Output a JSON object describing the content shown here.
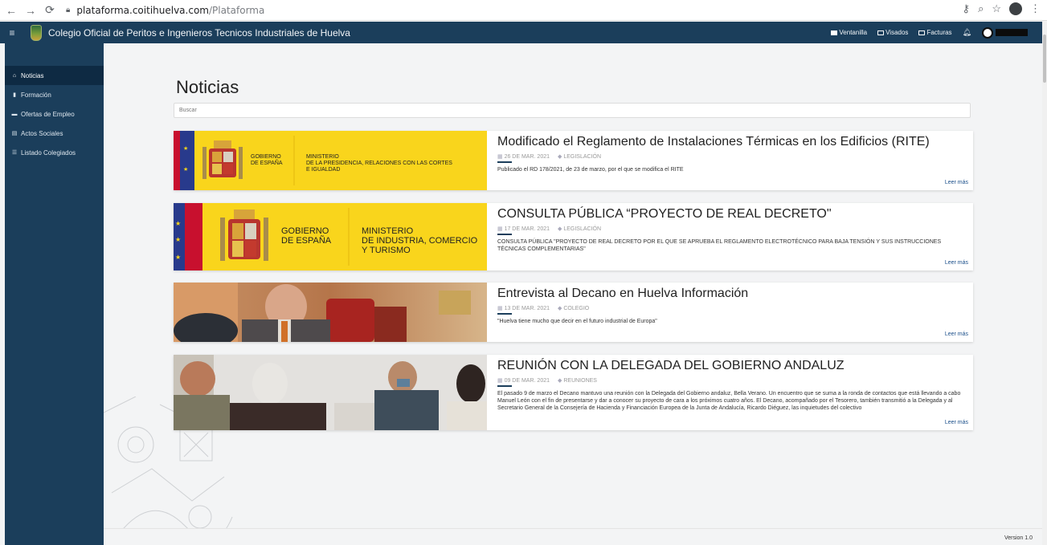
{
  "browser": {
    "url_host": "plataforma.coitihuelva.com",
    "url_path": "/Plataforma"
  },
  "header": {
    "title": "Colegio Oficial de Peritos e Ingenieros Tecnicos Industriales de Huelva",
    "menu": [
      {
        "label": "Ventanilla",
        "icon": "window-icon"
      },
      {
        "label": "Visados",
        "icon": "document-icon"
      },
      {
        "label": "Facturas",
        "icon": "invoice-icon"
      }
    ]
  },
  "sidebar": {
    "items": [
      {
        "label": "Noticias",
        "icon": "home-icon",
        "active": true
      },
      {
        "label": "Formación",
        "icon": "book-icon",
        "active": false
      },
      {
        "label": "Ofertas de Empleo",
        "icon": "briefcase-icon",
        "active": false
      },
      {
        "label": "Actos Sociales",
        "icon": "newspaper-icon",
        "active": false
      },
      {
        "label": "Listado Colegiados",
        "icon": "list-icon",
        "active": false
      }
    ]
  },
  "main": {
    "title": "Noticias",
    "search_placeholder": "Buscar",
    "read_more_label": "Leer más",
    "news": [
      {
        "title": "Modificado el Reglamento de Instalaciones Térmicas en los Edificios (RITE)",
        "date": "26 DE MAR. 2021",
        "category": "LEGISLACIÓN",
        "summary": "Publicado el RD 178/2021, de 23 de marzo, por el que se modifica el RITE",
        "image_left": "GOBIERNO\nDE ESPAÑA",
        "image_right": "MINISTERIO\nDE LA PRESIDENCIA, RELACIONES CON LAS CORTES\nE IGUALDAD"
      },
      {
        "title": "CONSULTA PÚBLICA “PROYECTO DE REAL DECRETO\"",
        "date": "17 DE MAR. 2021",
        "category": "LEGISLACIÓN",
        "summary": "CONSULTA PÚBLICA \"PROYECTO DE REAL DECRETO POR EL QUE SE APRUEBA EL REGLAMENTO ELECTROTÉCNICO PARA BAJA TENSIÓN Y SUS INSTRUCCIONES TÉCNICAS COMPLEMENTARIAS\"",
        "image_left": "GOBIERNO\nDE ESPAÑA",
        "image_right": "MINISTERIO\nDE INDUSTRIA, COMERCIO\nY TURISMO"
      },
      {
        "title": "Entrevista al Decano en Huelva Información",
        "date": "13 DE MAR. 2021",
        "category": "COLEGIO",
        "summary": "\"Huelva tiene mucho que decir en el futuro industrial de Europa\""
      },
      {
        "title": "REUNIÓN CON LA DELEGADA DEL GOBIERNO ANDALUZ",
        "date": "09 DE MAR. 2021",
        "category": "REUNIONES",
        "summary": "El pasado 9 de marzo el Decano mantuvo una reunión con la Delegada del Gobierno andaluz, Bella Verano. Un encuentro que se suma a la ronda de contactos que está llevando a cabo Manuel León con el fin de presentarse y dar a conocer su proyecto de cara a los próximos cuatro años. El Decano, acompañado por el Tesorero, también transmitió a la Delegada y al Secretario General de la Consejería de Hacienda y Financiación Europea de la Junta de Andalucía, Ricardo Diéguez, las inquietudes del colectivo"
      }
    ]
  },
  "footer": {
    "version": "Version 1.0"
  },
  "colors": {
    "header_bg": "#1b3e5b",
    "sidebar_active": "#0e2a43",
    "gov_yellow": "#f9d51c",
    "flag_red": "#c8102e"
  }
}
